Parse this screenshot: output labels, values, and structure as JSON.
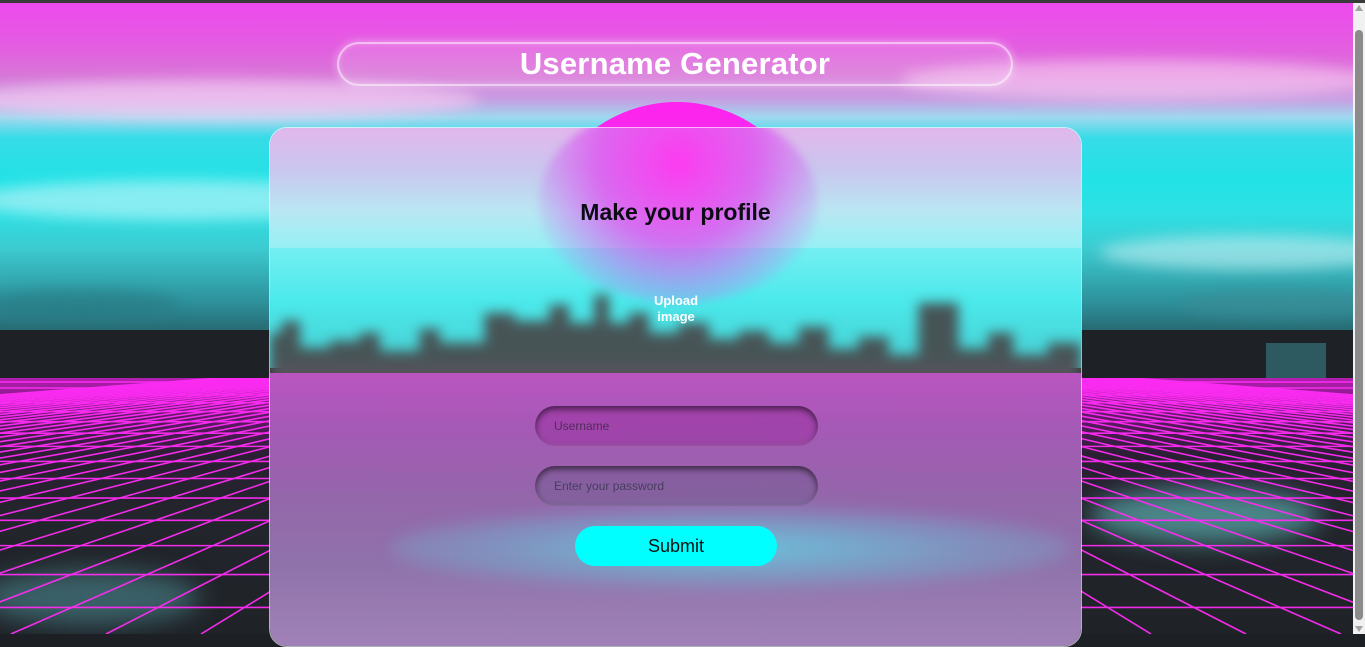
{
  "header": {
    "title": "Username Generator"
  },
  "card": {
    "heading": "Make your profile",
    "upload_label": "Upload\nimage",
    "username": {
      "placeholder": "Username",
      "value": ""
    },
    "password": {
      "placeholder": "Enter your password",
      "value": ""
    },
    "submit_label": "Submit"
  },
  "colors": {
    "accent_cyan": "#00ffff",
    "sky_magenta": "#ee48ee",
    "grid_magenta": "#ff2cf5",
    "card_border": "#ffffff"
  }
}
